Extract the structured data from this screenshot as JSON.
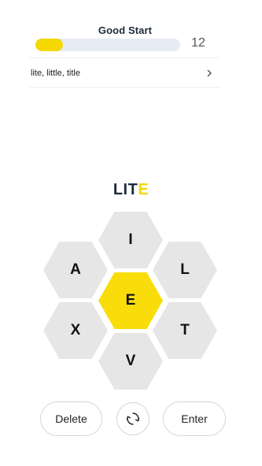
{
  "header": {
    "rank": "Good Start",
    "score": "12",
    "progress_fraction": 0.19
  },
  "found_words": {
    "text": "lite, little, title",
    "expand_icon": "chevron-right-icon"
  },
  "current_word": {
    "letters": [
      "L",
      "I",
      "T",
      "E"
    ],
    "center_letter": "E"
  },
  "hive": {
    "top": "I",
    "upper_left": "A",
    "upper_right": "L",
    "center": "E",
    "lower_left": "X",
    "lower_right": "T",
    "bottom": "V"
  },
  "controls": {
    "delete_label": "Delete",
    "shuffle_icon": "shuffle-icon",
    "enter_label": "Enter"
  },
  "colors": {
    "accent_yellow": "#f8dd0a",
    "hex_gray": "#e6e6e6",
    "progress_track": "#e7ebf3",
    "title_navy": "#1d2b3a"
  }
}
